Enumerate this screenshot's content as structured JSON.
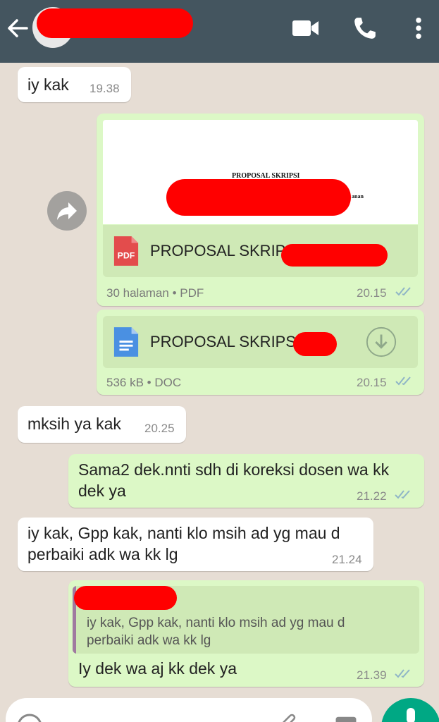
{
  "header": {
    "back_icon": "arrow-left-icon",
    "video_icon": "video-call-icon",
    "phone_icon": "phone-icon",
    "menu_icon": "more-vert-icon",
    "color": "#44555f"
  },
  "messages": [
    {
      "id": "m1",
      "direction": "incoming",
      "text": "iy kak",
      "time": "19.38"
    },
    {
      "id": "m2",
      "direction": "outgoing",
      "type": "document",
      "preview_title": "PROPOSAL SKRIPSI",
      "preview_right": "anan",
      "file_icon": "pdf-icon",
      "file_badge": "PDF",
      "file_name": "PROPOSAL SKRIPS",
      "meta": "30 halaman • PDF",
      "time": "20.15",
      "status": "read"
    },
    {
      "id": "m3",
      "direction": "outgoing",
      "type": "document",
      "file_icon": "doc-icon",
      "file_name": "PROPOSAL SKRIPSI",
      "ellipsis": "...",
      "meta": "536 kB • DOC",
      "time": "20.15",
      "status": "read",
      "action_icon": "download-icon"
    },
    {
      "id": "m4",
      "direction": "incoming",
      "text": "mksih ya kak",
      "time": "20.25"
    },
    {
      "id": "m5",
      "direction": "outgoing",
      "lines": [
        "Sama2 dek.nnti sdh di koreksi dosen wa kk",
        "dek ya"
      ],
      "time": "21.22",
      "status": "read"
    },
    {
      "id": "m6",
      "direction": "incoming",
      "lines": [
        "iy kak, Gpp kak, nanti klo msih ad yg mau d",
        "perbaiki adk wa kk lg"
      ],
      "time": "21.24"
    },
    {
      "id": "m7",
      "direction": "outgoing",
      "quote_lines": [
        "iy kak, Gpp kak, nanti klo msih ad yg mau d",
        "perbaiki adk wa kk lg"
      ],
      "text": "Iy dek wa aj kk dek ya",
      "time": "21.39",
      "status": "read"
    }
  ],
  "colors": {
    "incoming": "#ffffff",
    "outgoing": "#dcf8c6",
    "wallpaper": "#e6ddd4",
    "fab": "#00a884"
  },
  "composer": {
    "emoji_icon": "emoji-icon",
    "attach_icon": "paperclip-icon",
    "camera_icon": "camera-icon",
    "mic_icon": "mic-icon"
  }
}
